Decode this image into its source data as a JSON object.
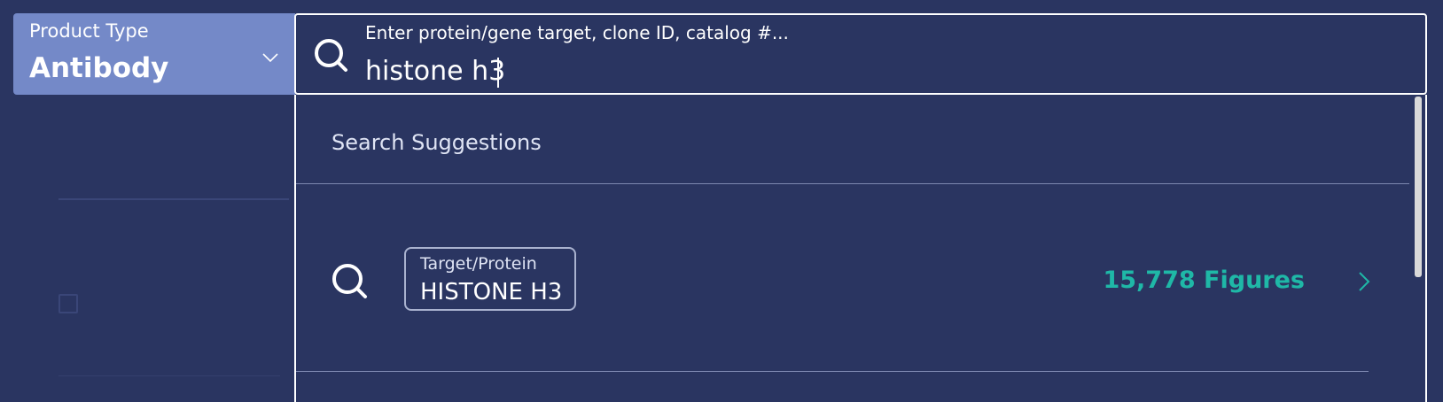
{
  "product_type": {
    "label": "Product Type",
    "value": "Antibody"
  },
  "search": {
    "label": "Enter protein/gene target, clone ID, catalog #...",
    "value": "histone h3"
  },
  "dropdown": {
    "header": "Search Suggestions",
    "suggestions": [
      {
        "type": "Target/Protein",
        "value": "HISTONE H3",
        "figures": "15,778 Figures"
      }
    ]
  },
  "colors": {
    "background": "#2a3561",
    "select_bg": "#7489c8",
    "accent": "#1fb8a7",
    "border": "#ffffff"
  },
  "icons": [
    "search-icon",
    "chevron-down-icon",
    "chevron-right-icon"
  ]
}
